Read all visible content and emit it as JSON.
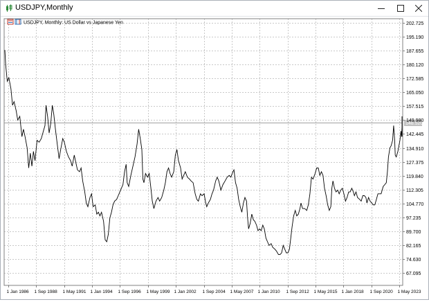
{
  "window": {
    "title": "USDJPY,Monthly",
    "icon": "candlestick-icon",
    "controls": {
      "minimize_icon": "minimize-icon",
      "maximize_icon": "maximize-icon",
      "close_icon": "close-icon"
    }
  },
  "chart": {
    "label": "USDJPY, Monthly:  US Dollar vs Japanese Yen",
    "current_price": "148.520",
    "colors": {
      "line": "#000000",
      "grid": "#c8c8c8",
      "axis_text": "#000000",
      "price_line": "#a0a0a0"
    }
  },
  "chart_data": {
    "type": "line",
    "title": "USDJPY, Monthly:  US Dollar vs Japanese Yen",
    "xlabel": "",
    "ylabel": "",
    "ylim": [
      61.0,
      205.0
    ],
    "grid": true,
    "y_ticks": [
      "202.725",
      "195.190",
      "187.655",
      "180.120",
      "172.585",
      "165.050",
      "157.515",
      "149.980",
      "142.445",
      "134.910",
      "127.375",
      "119.840",
      "112.305",
      "104.770",
      "97.235",
      "89.700",
      "82.165",
      "74.630",
      "67.095"
    ],
    "x_ticks": [
      {
        "label": "1 Jan 1986",
        "t": 1986.0
      },
      {
        "label": "1 Sep 1988",
        "t": 1988.667
      },
      {
        "label": "1 May 1991",
        "t": 1991.333
      },
      {
        "label": "1 Jan 1994",
        "t": 1994.0
      },
      {
        "label": "1 Sep 1996",
        "t": 1996.667
      },
      {
        "label": "1 May 1999",
        "t": 1999.333
      },
      {
        "label": "1 Jan 2002",
        "t": 2002.0
      },
      {
        "label": "1 Sep 2004",
        "t": 2004.667
      },
      {
        "label": "1 May 2007",
        "t": 2007.333
      },
      {
        "label": "1 Jan 2010",
        "t": 2010.0
      },
      {
        "label": "1 Sep 2012",
        "t": 2012.667
      },
      {
        "label": "1 May 2015",
        "t": 2015.333
      },
      {
        "label": "1 Jan 2018",
        "t": 2018.0
      },
      {
        "label": "1 Sep 2020",
        "t": 2020.667
      },
      {
        "label": "1 May 2023",
        "t": 2023.333
      }
    ],
    "series": [
      {
        "points": [
          [
            1985.5,
            188
          ],
          [
            1985.75,
            180
          ],
          [
            1985.9,
            171
          ],
          [
            1986.05,
            173
          ],
          [
            1986.25,
            167
          ],
          [
            1986.4,
            158
          ],
          [
            1986.55,
            160
          ],
          [
            1986.75,
            155
          ],
          [
            1986.9,
            150
          ],
          [
            1987.1,
            152
          ],
          [
            1987.3,
            141
          ],
          [
            1987.45,
            145
          ],
          [
            1987.6,
            141
          ],
          [
            1987.8,
            135
          ],
          [
            1987.95,
            124
          ],
          [
            1988.1,
            132
          ],
          [
            1988.25,
            125
          ],
          [
            1988.4,
            133
          ],
          [
            1988.55,
            128
          ],
          [
            1988.75,
            139
          ],
          [
            1988.95,
            138
          ],
          [
            1989.15,
            140
          ],
          [
            1989.35,
            144
          ],
          [
            1989.5,
            147
          ],
          [
            1989.6,
            158
          ],
          [
            1989.75,
            152
          ],
          [
            1989.9,
            143
          ],
          [
            1990.05,
            148
          ],
          [
            1990.2,
            158
          ],
          [
            1990.35,
            153
          ],
          [
            1990.5,
            145
          ],
          [
            1990.65,
            138
          ],
          [
            1990.85,
            129
          ],
          [
            1991.0,
            134
          ],
          [
            1991.2,
            140
          ],
          [
            1991.35,
            138
          ],
          [
            1991.55,
            133
          ],
          [
            1991.75,
            130
          ],
          [
            1991.95,
            128
          ],
          [
            1992.1,
            125
          ],
          [
            1992.3,
            131
          ],
          [
            1992.45,
            127
          ],
          [
            1992.6,
            123
          ],
          [
            1992.8,
            122
          ],
          [
            1992.95,
            124
          ],
          [
            1993.1,
            117
          ],
          [
            1993.3,
            111
          ],
          [
            1993.45,
            105
          ],
          [
            1993.6,
            103
          ],
          [
            1993.8,
            108
          ],
          [
            1993.95,
            110
          ],
          [
            1994.1,
            103
          ],
          [
            1994.3,
            104
          ],
          [
            1994.45,
            99
          ],
          [
            1994.6,
            100
          ],
          [
            1994.75,
            98
          ],
          [
            1994.9,
            100
          ],
          [
            1995.1,
            95
          ],
          [
            1995.25,
            85
          ],
          [
            1995.4,
            84
          ],
          [
            1995.55,
            88
          ],
          [
            1995.7,
            97
          ],
          [
            1995.85,
            100
          ],
          [
            1996.0,
            104
          ],
          [
            1996.15,
            106
          ],
          [
            1996.35,
            107
          ],
          [
            1996.5,
            109
          ],
          [
            1996.65,
            111
          ],
          [
            1996.8,
            113
          ],
          [
            1996.95,
            115
          ],
          [
            1997.1,
            122
          ],
          [
            1997.25,
            126
          ],
          [
            1997.35,
            116
          ],
          [
            1997.5,
            114
          ],
          [
            1997.7,
            120
          ],
          [
            1997.9,
            125
          ],
          [
            1998.1,
            130
          ],
          [
            1998.3,
            137
          ],
          [
            1998.45,
            145
          ],
          [
            1998.6,
            140
          ],
          [
            1998.75,
            134
          ],
          [
            1998.85,
            118
          ],
          [
            1998.95,
            116
          ],
          [
            1999.1,
            121
          ],
          [
            1999.3,
            119
          ],
          [
            1999.45,
            121
          ],
          [
            1999.6,
            114
          ],
          [
            1999.75,
            106
          ],
          [
            1999.9,
            102
          ],
          [
            2000.1,
            106
          ],
          [
            2000.3,
            108
          ],
          [
            2000.45,
            106
          ],
          [
            2000.65,
            108
          ],
          [
            2000.85,
            112
          ],
          [
            2001.0,
            116
          ],
          [
            2001.15,
            122
          ],
          [
            2001.3,
            124
          ],
          [
            2001.45,
            121
          ],
          [
            2001.6,
            119
          ],
          [
            2001.8,
            122
          ],
          [
            2001.95,
            131
          ],
          [
            2002.1,
            134
          ],
          [
            2002.25,
            128
          ],
          [
            2002.45,
            124
          ],
          [
            2002.6,
            118
          ],
          [
            2002.75,
            120
          ],
          [
            2002.9,
            122
          ],
          [
            2003.1,
            119
          ],
          [
            2003.3,
            118
          ],
          [
            2003.45,
            117
          ],
          [
            2003.65,
            116
          ],
          [
            2003.85,
            110
          ],
          [
            2004.0,
            107
          ],
          [
            2004.15,
            106
          ],
          [
            2004.35,
            110
          ],
          [
            2004.5,
            109
          ],
          [
            2004.7,
            110
          ],
          [
            2004.85,
            105
          ],
          [
            2004.95,
            103
          ],
          [
            2005.1,
            105
          ],
          [
            2005.3,
            107
          ],
          [
            2005.45,
            110
          ],
          [
            2005.6,
            112
          ],
          [
            2005.8,
            117
          ],
          [
            2005.95,
            119
          ],
          [
            2006.1,
            117
          ],
          [
            2006.3,
            112
          ],
          [
            2006.5,
            115
          ],
          [
            2006.7,
            117
          ],
          [
            2006.9,
            119
          ],
          [
            2007.1,
            120
          ],
          [
            2007.25,
            119
          ],
          [
            2007.45,
            122
          ],
          [
            2007.55,
            123
          ],
          [
            2007.7,
            116
          ],
          [
            2007.85,
            113
          ],
          [
            2008.0,
            107
          ],
          [
            2008.15,
            103
          ],
          [
            2008.3,
            100
          ],
          [
            2008.45,
            105
          ],
          [
            2008.6,
            108
          ],
          [
            2008.75,
            106
          ],
          [
            2008.85,
            97
          ],
          [
            2008.95,
            91
          ],
          [
            2009.1,
            94
          ],
          [
            2009.25,
            99
          ],
          [
            2009.4,
            96
          ],
          [
            2009.55,
            95
          ],
          [
            2009.7,
            93
          ],
          [
            2009.85,
            90
          ],
          [
            2010.0,
            91
          ],
          [
            2010.15,
            90
          ],
          [
            2010.3,
            93
          ],
          [
            2010.45,
            91
          ],
          [
            2010.6,
            86
          ],
          [
            2010.75,
            84
          ],
          [
            2010.9,
            82
          ],
          [
            2011.1,
            83
          ],
          [
            2011.25,
            81
          ],
          [
            2011.45,
            80
          ],
          [
            2011.6,
            79
          ],
          [
            2011.8,
            77
          ],
          [
            2011.95,
            77
          ],
          [
            2012.1,
            78
          ],
          [
            2012.25,
            82
          ],
          [
            2012.4,
            80
          ],
          [
            2012.55,
            78
          ],
          [
            2012.7,
            78
          ],
          [
            2012.85,
            80
          ],
          [
            2012.95,
            85
          ],
          [
            2013.1,
            92
          ],
          [
            2013.25,
            98
          ],
          [
            2013.4,
            101
          ],
          [
            2013.55,
            98
          ],
          [
            2013.7,
            99
          ],
          [
            2013.85,
            102
          ],
          [
            2013.95,
            105
          ],
          [
            2014.1,
            102
          ],
          [
            2014.3,
            102
          ],
          [
            2014.5,
            101
          ],
          [
            2014.65,
            104
          ],
          [
            2014.8,
            110
          ],
          [
            2014.95,
            119
          ],
          [
            2015.1,
            118
          ],
          [
            2015.3,
            121
          ],
          [
            2015.45,
            124
          ],
          [
            2015.6,
            124
          ],
          [
            2015.75,
            120
          ],
          [
            2015.9,
            122
          ],
          [
            2016.05,
            120
          ],
          [
            2016.2,
            113
          ],
          [
            2016.35,
            109
          ],
          [
            2016.5,
            104
          ],
          [
            2016.65,
            101
          ],
          [
            2016.8,
            103
          ],
          [
            2016.9,
            113
          ],
          [
            2017.0,
            117
          ],
          [
            2017.15,
            113
          ],
          [
            2017.3,
            111
          ],
          [
            2017.45,
            112
          ],
          [
            2017.6,
            110
          ],
          [
            2017.75,
            112
          ],
          [
            2017.9,
            113
          ],
          [
            2018.05,
            110
          ],
          [
            2018.2,
            106
          ],
          [
            2018.35,
            108
          ],
          [
            2018.5,
            111
          ],
          [
            2018.65,
            111
          ],
          [
            2018.8,
            113
          ],
          [
            2018.95,
            111
          ],
          [
            2019.05,
            109
          ],
          [
            2019.2,
            111
          ],
          [
            2019.35,
            108
          ],
          [
            2019.55,
            107
          ],
          [
            2019.7,
            106
          ],
          [
            2019.85,
            109
          ],
          [
            2020.0,
            109
          ],
          [
            2020.15,
            108
          ],
          [
            2020.25,
            105
          ],
          [
            2020.4,
            108
          ],
          [
            2020.55,
            106
          ],
          [
            2020.7,
            105
          ],
          [
            2020.85,
            104
          ],
          [
            2021.0,
            104
          ],
          [
            2021.15,
            107
          ],
          [
            2021.3,
            110
          ],
          [
            2021.45,
            110
          ],
          [
            2021.6,
            110
          ],
          [
            2021.8,
            114
          ],
          [
            2021.95,
            115
          ],
          [
            2022.1,
            116
          ],
          [
            2022.2,
            122
          ],
          [
            2022.3,
            130
          ],
          [
            2022.45,
            135
          ],
          [
            2022.55,
            136
          ],
          [
            2022.7,
            139
          ],
          [
            2022.8,
            147
          ],
          [
            2022.9,
            139
          ],
          [
            2022.95,
            131
          ],
          [
            2023.05,
            130
          ],
          [
            2023.2,
            133
          ],
          [
            2023.3,
            136
          ],
          [
            2023.4,
            139
          ],
          [
            2023.5,
            144
          ],
          [
            2023.55,
            141
          ],
          [
            2023.65,
            146
          ],
          [
            2023.75,
            149
          ],
          [
            2023.85,
            150
          ],
          [
            2023.95,
            141
          ],
          [
            2024.05,
            148
          ],
          [
            2024.15,
            150
          ],
          [
            2024.25,
            152
          ]
        ]
      }
    ]
  }
}
